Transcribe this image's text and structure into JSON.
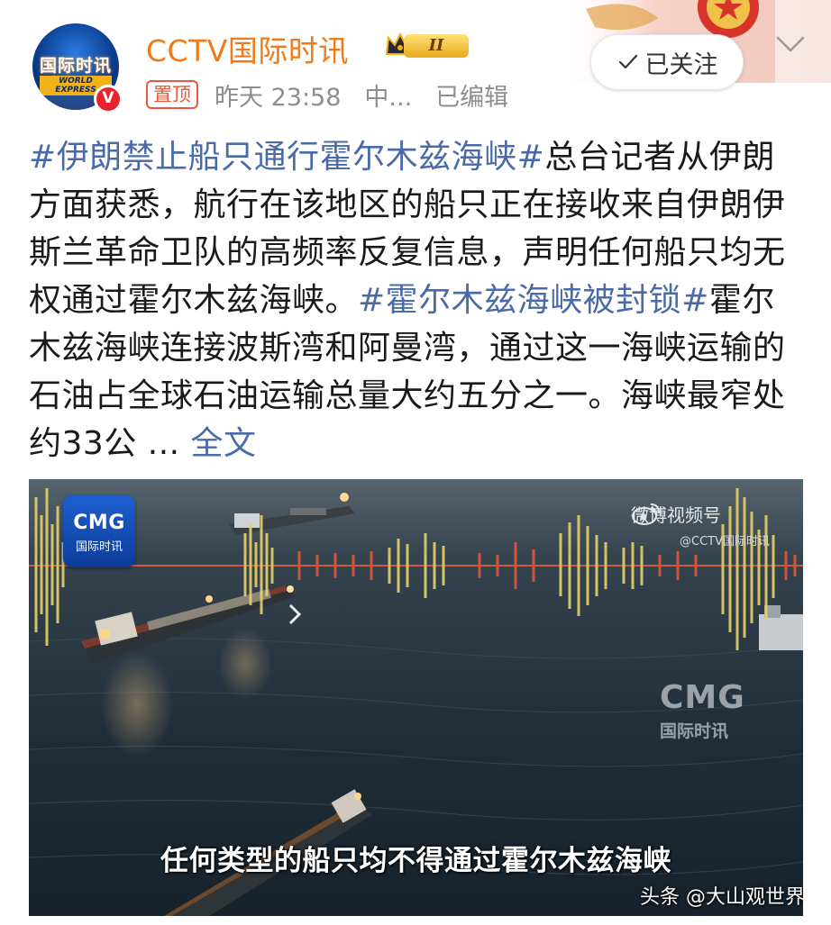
{
  "header": {
    "avatar_text": "国际时讯",
    "avatar_subtext": "WORLD EXPRESS",
    "verified_badge": "V",
    "username": "CCTV国际时讯",
    "level_badge": "II",
    "pinned_tag": "置顶",
    "timestamp": "昨天 23:58",
    "source": "中...",
    "edited": "已编辑",
    "follow_button": "已关注",
    "icons": {
      "check": "check-icon",
      "menu": "chevron-down-icon",
      "crown": "crown-icon"
    }
  },
  "post": {
    "hashtag1": "#伊朗禁止船只通行霍尔木兹海峡#",
    "text1": "总台记者从伊朗方面获悉，航行在该地区的船只正在接收来自伊朗伊斯兰革命卫队的高频率反复信息，声明任何船只均无权通过霍尔木兹海峡。",
    "hashtag2": "#霍尔木兹海峡被封锁#",
    "text2": "霍尔木兹海峡连接波斯湾和阿曼湾，通过这一海峡运输的石油占全球石油运输总量大约五分之一。海峡最窄处约33公 ...",
    "more_link": "全文"
  },
  "video": {
    "cmg_logo": "CMG",
    "cmg_logo_sub": "国际时讯",
    "weibo_label": "微博视频号",
    "weibo_handle": "@CCTV国际时讯",
    "watermark": "CMG",
    "watermark_sub": "国际时讯",
    "subtitle": "任何类型的船只均不得通过霍尔木兹海峡",
    "source_credit": "头条 @大山观世界"
  },
  "colors": {
    "username": "#ef7a1a",
    "hashtag": "#4a6ba8",
    "pinned": "#e9573f",
    "verified": "#e8232b",
    "meta_text": "#8e8e8e"
  }
}
